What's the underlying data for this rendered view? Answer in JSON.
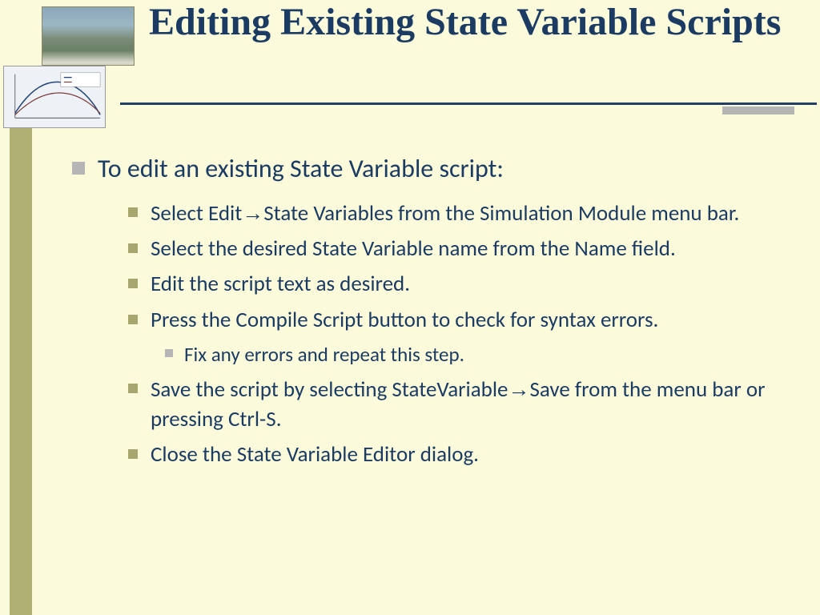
{
  "title": "Editing Existing State Variable Scripts",
  "intro": "To edit an existing State Variable script:",
  "steps": [
    {
      "pre": "Select Edit",
      "arrow": true,
      "post": "State Variables from the Simulation Module menu bar."
    },
    {
      "pre": "Select the desired State Variable name from the Name field.",
      "arrow": false,
      "post": ""
    },
    {
      "pre": "Edit the script text as desired.",
      "arrow": false,
      "post": ""
    },
    {
      "pre": "Press the Compile Script button to check for syntax errors.",
      "arrow": false,
      "post": "",
      "sub": "Fix any errors and repeat this step."
    },
    {
      "pre": "Save the script by selecting StateVariable",
      "arrow": true,
      "post": "Save from the menu bar or pressing Ctrl-S."
    },
    {
      "pre": "Close the State Variable Editor dialog.",
      "arrow": false,
      "post": ""
    }
  ],
  "arrow_glyph": "→"
}
